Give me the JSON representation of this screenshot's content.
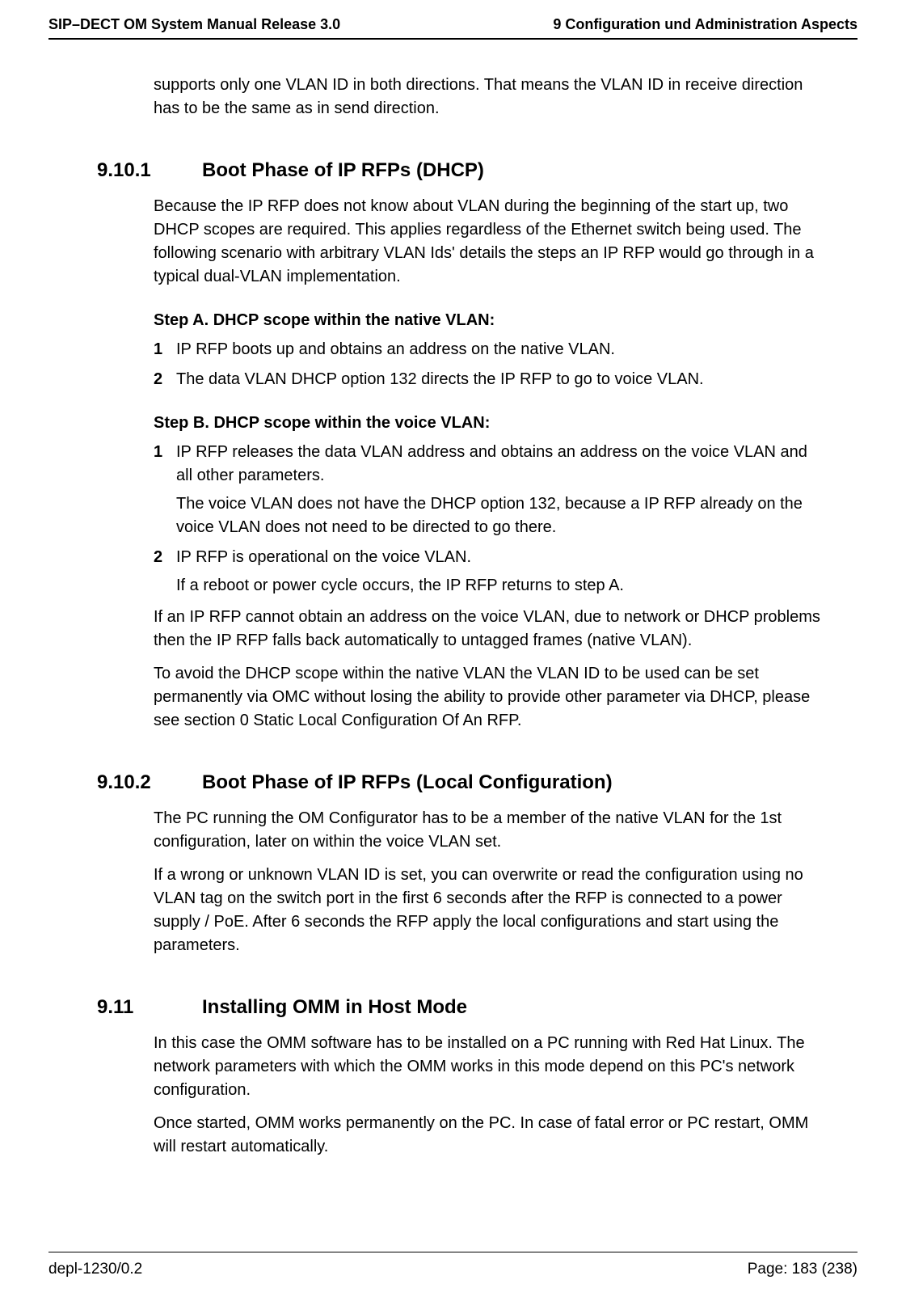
{
  "header": {
    "left": "SIP–DECT OM System Manual Release 3.0",
    "right": "9 Configuration und Administration Aspects"
  },
  "intro_para": "supports only one VLAN ID in both directions. That means the VLAN ID in receive direction has to be the same as in send direction.",
  "sec1": {
    "num": "9.10.1",
    "title": "Boot Phase of IP RFPs (DHCP)",
    "para": "Because the IP RFP does not know about VLAN during the beginning of the start up, two DHCP scopes are required. This applies regardless of the Ethernet switch being used. The following scenario with arbitrary VLAN Ids' details the steps an IP RFP would go through in a typical dual-VLAN implementation.",
    "stepA": {
      "head": "Step A. DHCP scope within the native VLAN:",
      "items": [
        "IP RFP boots up and obtains an address on the native VLAN.",
        "The data VLAN DHCP option 132 directs the IP RFP to go to voice VLAN."
      ]
    },
    "stepB": {
      "head": "Step B. DHCP scope within the voice VLAN:",
      "items": [
        {
          "main": "IP RFP releases the data VLAN address and obtains an address on the voice VLAN and all other parameters.",
          "sub": "The voice VLAN does not have the DHCP option 132, because a IP RFP already on the voice VLAN does not need to be directed to go there."
        },
        {
          "main": "IP RFP is operational on the voice VLAN.",
          "sub": "If a reboot or power cycle occurs, the IP RFP returns to step A."
        }
      ]
    },
    "tail1": "If an IP RFP cannot obtain an address on the voice VLAN, due to network or DHCP problems then the IP RFP falls back automatically to untagged frames (native VLAN).",
    "tail2": "To avoid the DHCP scope within the native VLAN the VLAN ID to be used can be set permanently via OMC without losing the ability to provide other parameter via DHCP, please see section 0 Static Local Configuration Of An RFP."
  },
  "sec2": {
    "num": "9.10.2",
    "title": "Boot Phase of IP RFPs (Local Configuration)",
    "para1": "The PC running the OM Configurator has to be a member of the native VLAN for the 1st configuration, later on within the voice VLAN set.",
    "para2": "If a wrong or unknown VLAN ID is set, you can overwrite or read the configuration using no VLAN tag on the switch port in the first 6 seconds after the RFP is connected to a power supply / PoE. After 6 seconds the RFP apply the local configurations and start using the parameters."
  },
  "sec3": {
    "num": "9.11",
    "title": "Installing OMM in Host Mode",
    "para1": "In this case the OMM software has to be installed on a PC running with Red Hat Linux. The network parameters with which the OMM works in this mode depend on this PC's network configuration.",
    "para2": "Once started, OMM works permanently on the PC. In case of fatal error or PC restart, OMM will restart automatically."
  },
  "footer": {
    "left": "depl-1230/0.2",
    "right": "Page: 183 (238)"
  }
}
